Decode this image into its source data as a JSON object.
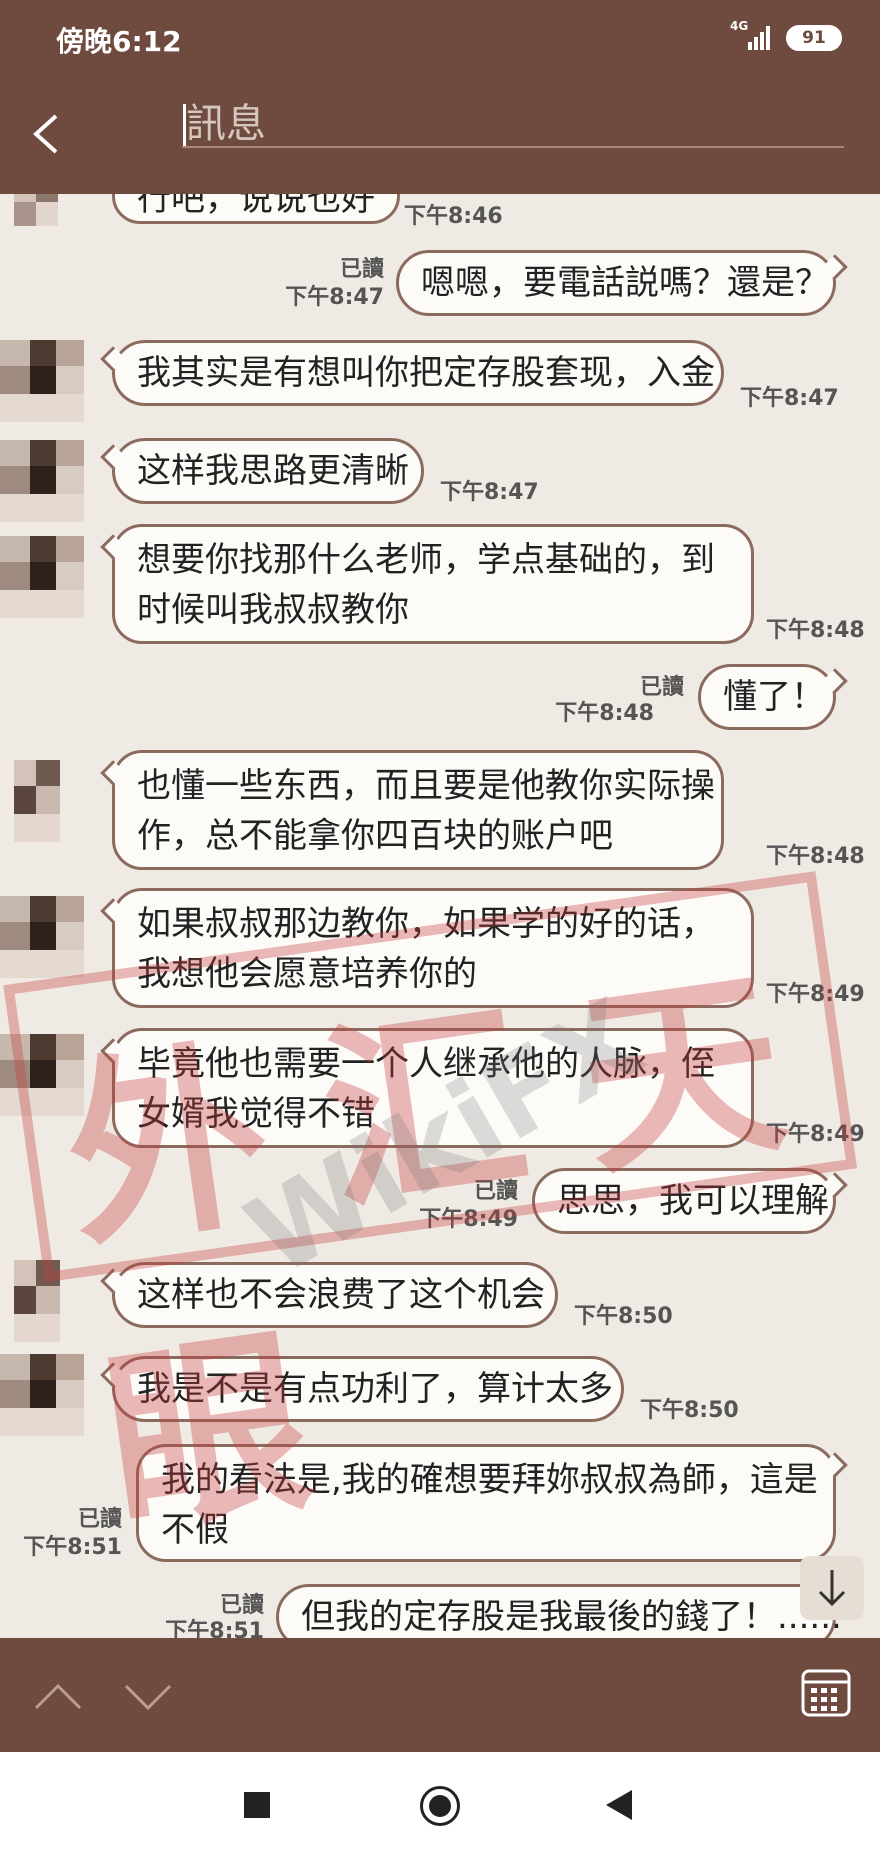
{
  "status_bar": {
    "time": "傍晚6:12",
    "network": "4G",
    "battery": "91"
  },
  "header": {
    "title": "訊息"
  },
  "messages": [
    {
      "text": "行吧，说说也好",
      "time": "下午8:46"
    },
    {
      "text": "嗯嗯，要電話説嗎？還是？",
      "time": "下午8:47",
      "read": "已讀"
    },
    {
      "text": "我其实是有想叫你把定存股套现，入金",
      "time": "下午8:47"
    },
    {
      "text": "这样我思路更清晰",
      "time": "下午8:47"
    },
    {
      "lines": [
        "想要你找那什么老师，学点基础的，到",
        "时候叫我叔叔教你"
      ],
      "time": "下午8:48"
    },
    {
      "text": "懂了！",
      "time": "下午8:48",
      "read": "已讀"
    },
    {
      "lines": [
        "也懂一些东西，而且要是他教你实际操",
        "作，总不能拿你四百块的账户吧"
      ],
      "time": "下午8:48"
    },
    {
      "lines": [
        "如果叔叔那边教你，如果学的好的话，",
        "我想他会愿意培养你的"
      ],
      "time": "下午8:49"
    },
    {
      "lines": [
        "毕竟他也需要一个人继承他的人脉，侄",
        "女婿我觉得不错"
      ],
      "time": "下午8:49"
    },
    {
      "text": "思思，我可以理解",
      "time": "下午8:49",
      "read": "已讀"
    },
    {
      "text": "这样也不会浪费了这个机会",
      "time": "下午8:50"
    },
    {
      "text": "我是不是有点功利了，算计太多",
      "time": "下午8:50"
    },
    {
      "lines": [
        "我的看法是,我的確想要拜妳叔叔為師，這是",
        "不假"
      ],
      "time": "下午8:51",
      "read": "已讀"
    },
    {
      "text": "但我的定存股是我最後的錢了！......",
      "time": "下午8:51",
      "read": "已讀"
    }
  ],
  "watermark": {
    "stamp": "外汇天眼",
    "brand": "WikiFX"
  },
  "icons": {
    "back": "chevron-left-icon",
    "scroll": "arrow-down-icon",
    "prev": "chevron-up-icon",
    "next": "chevron-down-icon",
    "calendar": "calendar-icon",
    "recents": "square-icon",
    "home": "circle-icon",
    "nav_back": "triangle-left-icon"
  },
  "colors": {
    "bar": "#6e4a3f",
    "bubble_border": "#8b6b5e",
    "bubble_bg": "#fdfbf8",
    "chat_bg": "#efebe4",
    "stamp": "#c63b3b"
  }
}
